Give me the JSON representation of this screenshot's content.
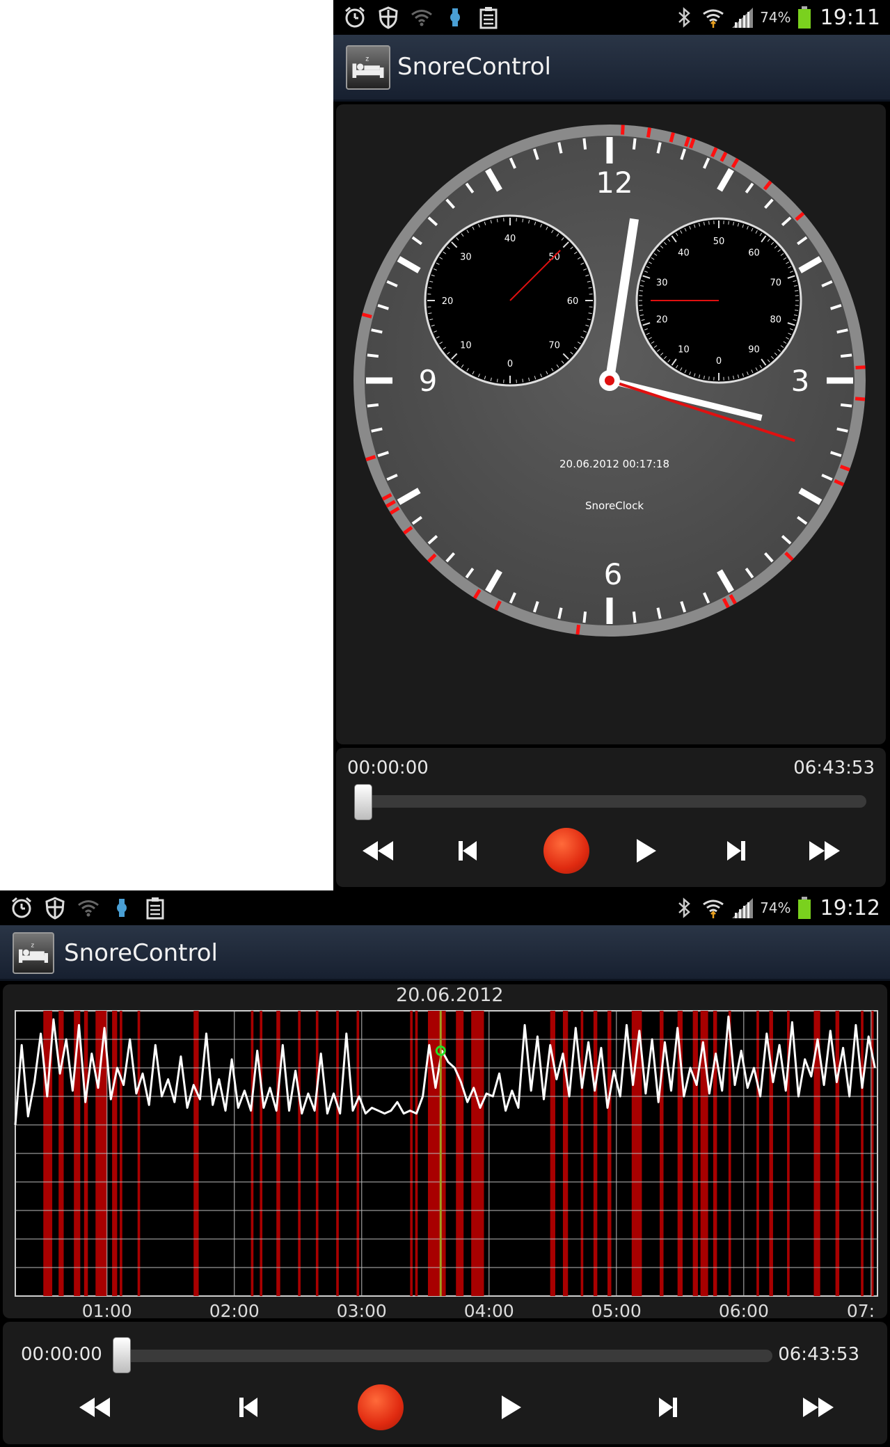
{
  "status_top": {
    "battery": "74%",
    "time": "19:11"
  },
  "status_bottom": {
    "battery": "74%",
    "time": "19:12"
  },
  "app": {
    "title": "SnoreControl"
  },
  "clock": {
    "numerals": [
      "12",
      "3",
      "6",
      "9"
    ],
    "datetime": "20.06.2012 00:17:18",
    "label": "SnoreClock",
    "hour_hand_hours": 0.29,
    "minute_hand_minutes": 17.3,
    "second_hand_seconds": 18,
    "left_subdial": {
      "labels": [
        "0",
        "10",
        "20",
        "30",
        "40",
        "50",
        "60",
        "70"
      ],
      "pointer_value": 50
    },
    "right_subdial": {
      "labels": [
        "0",
        "10",
        "20",
        "30",
        "40",
        "50",
        "60",
        "70",
        "80",
        "90"
      ],
      "pointer_value": 25
    },
    "snore_marks_minutes": [
      0.5,
      1.5,
      2.4,
      3.0,
      3.2,
      4.1,
      4.5,
      5.0,
      6.5,
      8.2,
      14.5,
      15.7,
      18.4,
      19.0,
      22.4,
      25.1,
      25.4,
      31.2,
      34.4,
      35.3,
      37.5,
      38.9,
      39.8,
      40.1,
      40.4,
      42.0,
      47.5
    ]
  },
  "player_top": {
    "start_time": "00:00:00",
    "end_time": "06:43:53",
    "position": 0
  },
  "player_bottom": {
    "start_time": "00:00:00",
    "end_time": "06:43:53",
    "position": 0
  },
  "chart_data": {
    "type": "line",
    "title": "20.06.2012",
    "xlabel": "",
    "ylabel": "",
    "x_ticks": [
      "01:00",
      "02:00",
      "03:00",
      "04:00",
      "05:00",
      "06:00",
      "07:"
    ],
    "xlim_hours": [
      0.28,
      7.05
    ],
    "ylim": [
      0,
      100
    ],
    "grid": true,
    "cursor_hour": 3.62,
    "cursor_value": 86,
    "snore_bars_hours": [
      [
        0.52,
        0.54
      ],
      [
        0.5,
        0.57
      ],
      [
        0.62,
        0.66
      ],
      [
        0.74,
        0.79
      ],
      [
        0.82,
        0.85
      ],
      [
        0.91,
        1.0
      ],
      [
        1.04,
        1.08
      ],
      [
        1.1,
        1.12
      ],
      [
        1.24,
        1.26
      ],
      [
        1.68,
        1.72
      ],
      [
        2.13,
        2.15
      ],
      [
        2.2,
        2.22
      ],
      [
        2.33,
        2.36
      ],
      [
        2.5,
        2.52
      ],
      [
        2.64,
        2.66
      ],
      [
        2.8,
        2.82
      ],
      [
        2.96,
        2.98
      ],
      [
        3.38,
        3.4
      ],
      [
        3.42,
        3.44
      ],
      [
        3.52,
        3.66
      ],
      [
        3.74,
        3.8
      ],
      [
        3.86,
        3.96
      ],
      [
        4.48,
        4.52
      ],
      [
        4.58,
        4.62
      ],
      [
        4.72,
        4.74
      ],
      [
        4.82,
        4.85
      ],
      [
        4.93,
        4.96
      ],
      [
        5.12,
        5.2
      ],
      [
        5.34,
        5.37
      ],
      [
        5.48,
        5.52
      ],
      [
        5.6,
        5.64
      ],
      [
        5.66,
        5.72
      ],
      [
        5.76,
        5.79
      ],
      [
        5.88,
        5.9
      ],
      [
        6.1,
        6.12
      ],
      [
        6.2,
        6.23
      ],
      [
        6.34,
        6.36
      ],
      [
        6.55,
        6.6
      ],
      [
        6.72,
        6.75
      ],
      [
        6.92,
        6.94
      ],
      [
        7.0,
        7.02
      ]
    ],
    "series": [
      {
        "x": [
          0.28,
          0.33,
          0.38,
          0.43,
          0.48,
          0.53,
          0.58,
          0.63,
          0.68,
          0.73,
          0.78,
          0.83,
          0.88,
          0.93,
          0.98,
          1.03,
          1.08,
          1.13,
          1.18,
          1.23,
          1.28,
          1.33,
          1.38,
          1.43,
          1.48,
          1.53,
          1.58,
          1.63,
          1.68,
          1.73,
          1.78,
          1.83,
          1.88,
          1.93,
          1.98,
          2.03,
          2.08,
          2.13,
          2.18,
          2.23,
          2.28,
          2.33,
          2.38,
          2.43,
          2.48,
          2.53,
          2.58,
          2.63,
          2.68,
          2.73,
          2.78,
          2.83,
          2.88,
          2.93,
          2.98,
          3.03,
          3.08,
          3.13,
          3.18,
          3.23,
          3.28,
          3.33,
          3.38,
          3.43,
          3.48,
          3.53,
          3.58,
          3.63,
          3.68,
          3.73,
          3.78,
          3.83,
          3.88,
          3.93,
          3.98,
          4.03,
          4.08,
          4.13,
          4.18,
          4.23,
          4.28,
          4.33,
          4.38,
          4.43,
          4.48,
          4.53,
          4.58,
          4.63,
          4.68,
          4.73,
          4.78,
          4.83,
          4.88,
          4.93,
          4.98,
          5.03,
          5.08,
          5.13,
          5.18,
          5.23,
          5.28,
          5.33,
          5.38,
          5.43,
          5.48,
          5.53,
          5.58,
          5.63,
          5.68,
          5.73,
          5.78,
          5.83,
          5.88,
          5.93,
          5.98,
          6.03,
          6.08,
          6.13,
          6.18,
          6.23,
          6.28,
          6.33,
          6.38,
          6.43,
          6.48,
          6.53,
          6.58,
          6.63,
          6.68,
          6.73,
          6.78,
          6.83,
          6.88,
          6.93,
          6.98,
          7.03
        ],
        "values": [
          60,
          88,
          63,
          75,
          92,
          70,
          97,
          78,
          90,
          72,
          95,
          68,
          85,
          73,
          94,
          69,
          80,
          74,
          90,
          71,
          78,
          67,
          88,
          70,
          76,
          68,
          84,
          66,
          74,
          69,
          92,
          67,
          76,
          65,
          83,
          66,
          72,
          65,
          86,
          66,
          73,
          65,
          88,
          65,
          79,
          64,
          71,
          65,
          85,
          64,
          71,
          64,
          92,
          65,
          70,
          64,
          66,
          65,
          64,
          65,
          68,
          64,
          65,
          64,
          70,
          88,
          73,
          86,
          82,
          80,
          75,
          68,
          73,
          66,
          71,
          70,
          78,
          65,
          72,
          66,
          95,
          72,
          91,
          69,
          88,
          76,
          85,
          70,
          94,
          73,
          89,
          72,
          87,
          66,
          79,
          70,
          95,
          74,
          93,
          71,
          90,
          68,
          89,
          72,
          94,
          70,
          80,
          74,
          89,
          71,
          85,
          72,
          98,
          74,
          86,
          73,
          80,
          70,
          92,
          75,
          88,
          72,
          96,
          70,
          83,
          77,
          90,
          74,
          93,
          75,
          87,
          70,
          95,
          73,
          91,
          80
        ]
      }
    ]
  }
}
